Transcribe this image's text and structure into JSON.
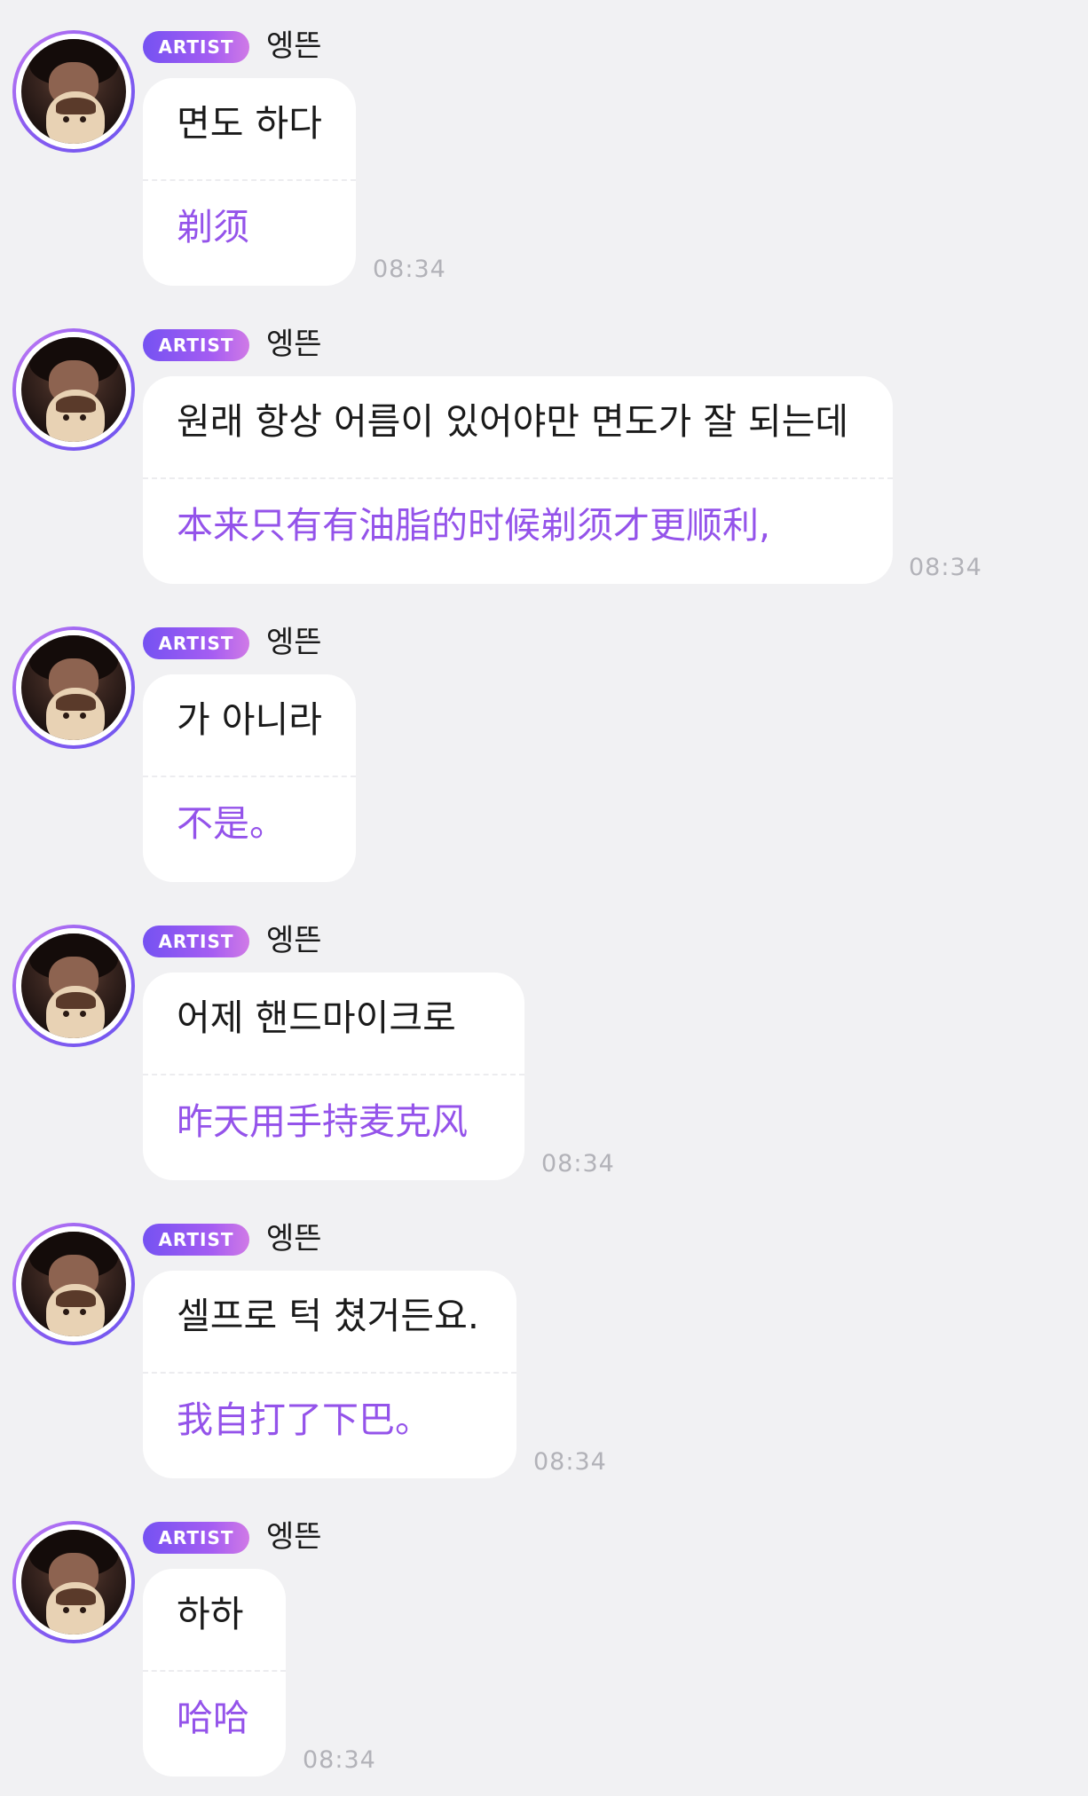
{
  "messages": [
    {
      "badge": "ARTIST",
      "name": "엥뜬",
      "ko": "면도 하다",
      "zh": "剃须",
      "time": "08:34"
    },
    {
      "badge": "ARTIST",
      "name": "엥뜬",
      "ko": "원래 항상 어름이 있어야만 면도가 잘 되는데",
      "zh": "本来只有有油脂的时候剃须才更顺利,",
      "time": "08:34"
    },
    {
      "badge": "ARTIST",
      "name": "엥뜬",
      "ko": "가 아니라",
      "zh": "不是。",
      "time": ""
    },
    {
      "badge": "ARTIST",
      "name": "엥뜬",
      "ko": "어제 핸드마이크로",
      "zh": "昨天用手持麦克风",
      "time": "08:34"
    },
    {
      "badge": "ARTIST",
      "name": "엥뜬",
      "ko": "셀프로 턱 쳤거든요.",
      "zh": "我自打了下巴。",
      "time": "08:34"
    },
    {
      "badge": "ARTIST",
      "name": "엥뜬",
      "ko": "하하",
      "zh": "哈哈",
      "time": "08:34"
    }
  ],
  "colors": {
    "background": "#f1f1f3",
    "bubble": "#ffffff",
    "translation_text": "#9453ea",
    "badge_gradient": [
      "#7552f2",
      "#d07ae6"
    ],
    "time_text": "#b2b2b8"
  },
  "icons": {
    "avatar": "profile-photo-with-plush-doll"
  }
}
